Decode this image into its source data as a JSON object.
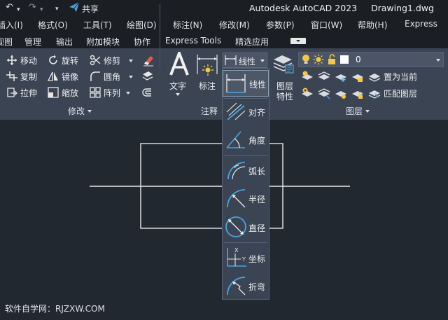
{
  "titlebar": {
    "share_label": "共享",
    "app_title": "Autodesk AutoCAD 2023",
    "document_name": "Drawing1.dwg"
  },
  "menu": {
    "items": [
      "插入(I)",
      "格式(O)",
      "工具(T)",
      "绘图(D)",
      "标注(N)",
      "修改(M)",
      "参数(P)",
      "窗口(W)",
      "帮助(H)",
      "Express"
    ]
  },
  "tabs": [
    "视图",
    "管理",
    "输出",
    "附加模块",
    "协作",
    "Express Tools",
    "精选应用"
  ],
  "ribbon": {
    "modify": {
      "title": "修改",
      "buttons": [
        "移动",
        "旋转",
        "修剪",
        "复制",
        "镜像",
        "圆角",
        "拉伸",
        "缩放",
        "阵列"
      ]
    },
    "annotation": {
      "title": "注释",
      "text_label": "文字",
      "dim_label": "标注",
      "linear_label": "线性"
    },
    "layers": {
      "title": "图层",
      "properties_label_1": "图层",
      "properties_label_2": "特性",
      "current_layer": "0",
      "set_current_label": "置为当前",
      "match_layer_label": "匹配图层"
    }
  },
  "dimension_dropdown": {
    "items": [
      "线性",
      "对齐",
      "角度",
      "弧长",
      "半径",
      "直径",
      "坐标",
      "折弯"
    ],
    "selected": "线性"
  },
  "watermark": "软件自学网：RJZXW.COM",
  "colors": {
    "ribbon_bg": "#3b4453",
    "canvas_bg": "#212830",
    "accent_blue": "#4aa3e0",
    "bulb_yellow": "#f5c842"
  }
}
